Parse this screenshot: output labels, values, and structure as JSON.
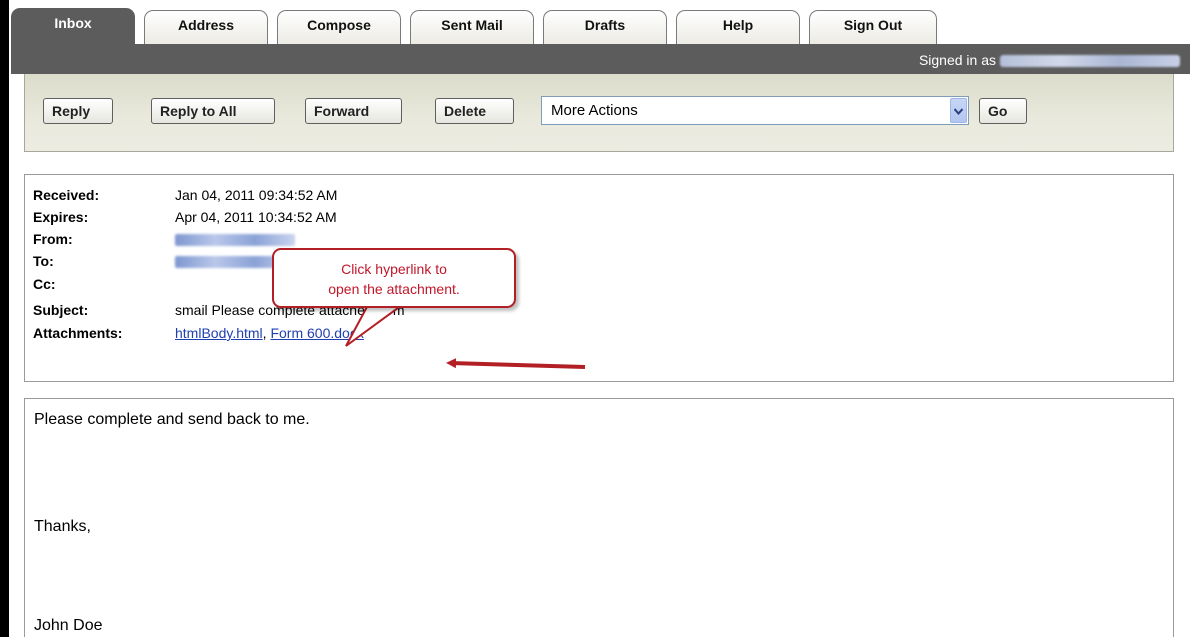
{
  "tabs": [
    {
      "label": "Inbox",
      "active": true
    },
    {
      "label": "Address"
    },
    {
      "label": "Compose"
    },
    {
      "label": "Sent Mail"
    },
    {
      "label": "Drafts"
    },
    {
      "label": "Help"
    },
    {
      "label": "Sign Out"
    }
  ],
  "account": {
    "signed_in_label": "Signed in as"
  },
  "toolbar": {
    "reply": "Reply",
    "reply_all": "Reply to All",
    "forward": "Forward",
    "delete": "Delete",
    "more_actions": "More Actions",
    "go": "Go"
  },
  "message": {
    "received_label": "Received:",
    "received": "Jan 04, 2011 09:34:52 AM",
    "expires_label": "Expires:",
    "expires": "Apr 04, 2011 10:34:52 AM",
    "from_label": "From:",
    "to_label": "To:",
    "cc_label": "Cc:",
    "subject_label": "Subject:",
    "subject": "smail Please complete attached form",
    "attachments_label": "Attachments:",
    "attachments": [
      "htmlBody.html",
      "Form 600.docx"
    ],
    "attachment_sep": ", "
  },
  "callout": {
    "line1": "Click hyperlink to",
    "line2": "open the attachment."
  },
  "body": {
    "line1": "Please complete and send back to me.",
    "line2": "Thanks,",
    "line3": "John Doe"
  },
  "colors": {
    "tabbar": "#5c5c5c",
    "toolbar": "#e6e6d8",
    "link": "#1f3fb0",
    "callout": "#b21f24"
  }
}
